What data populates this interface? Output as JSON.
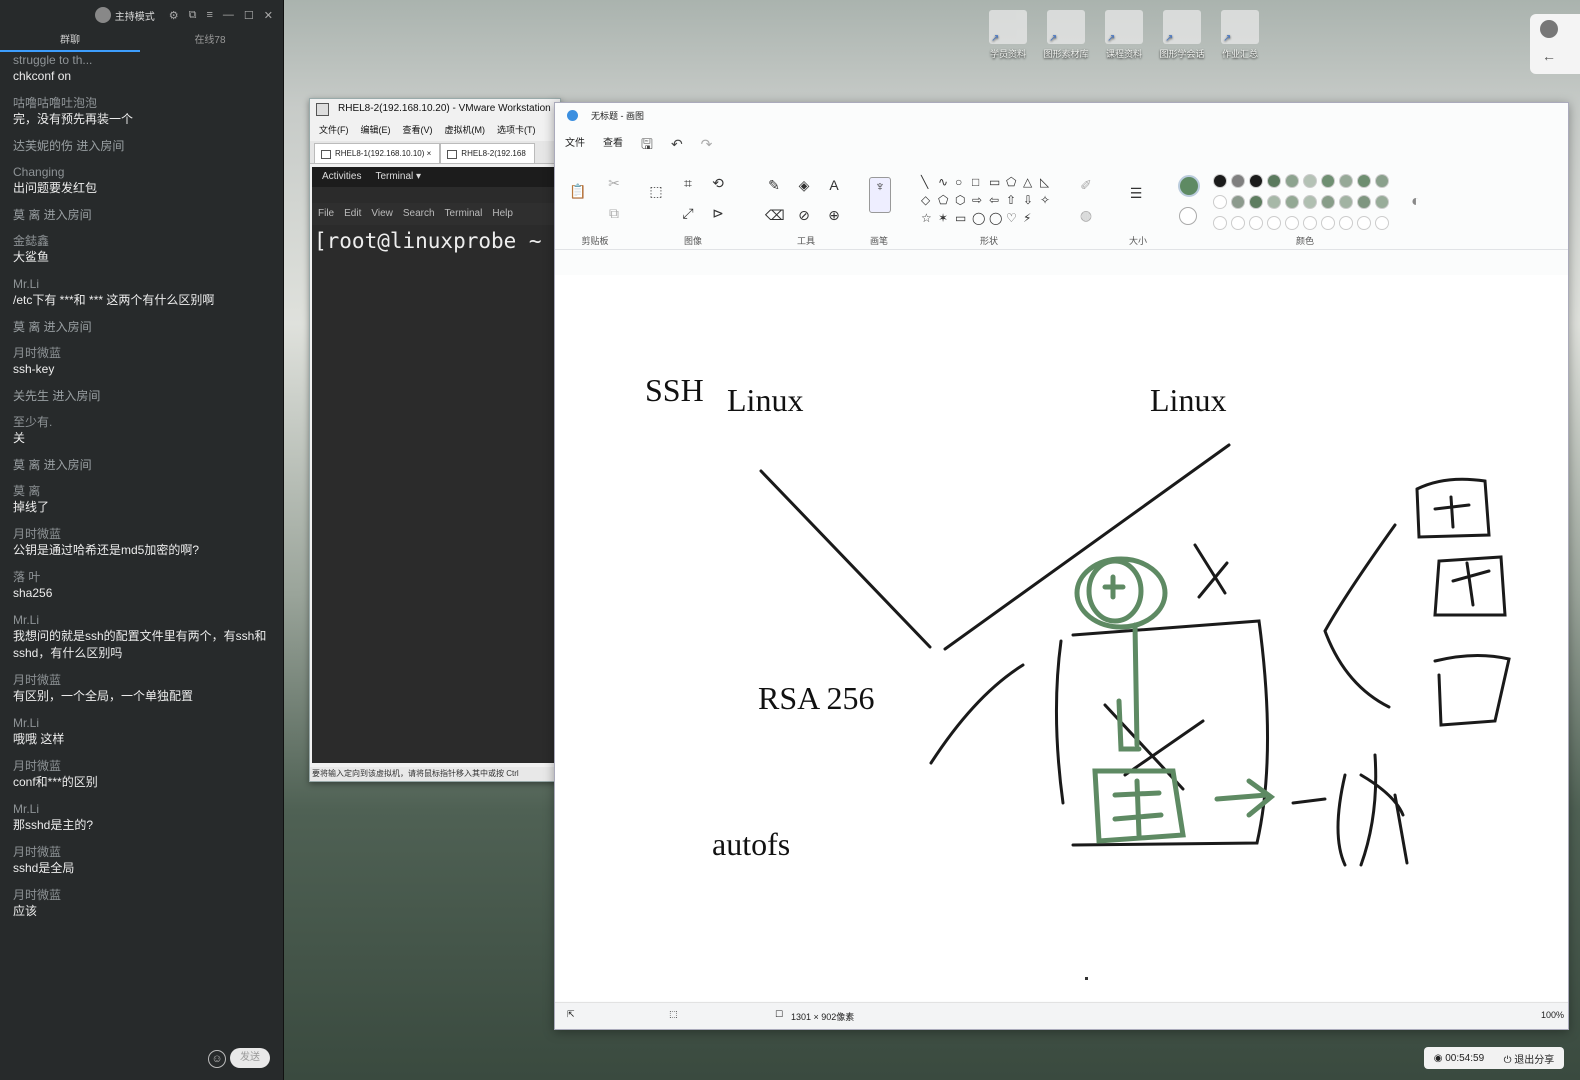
{
  "chat": {
    "mode_label": "主持模式",
    "tabs": [
      {
        "label": "群聊"
      },
      {
        "label": "在线78"
      }
    ],
    "messages": [
      {
        "nick": "struggle to th...",
        "text": "chkconf on"
      },
      {
        "nick": "咕噜咕噜吐泡泡",
        "text": "完，没有预先再装一个"
      },
      {
        "nick": "达芙妮的伤 进入房间",
        "text": ""
      },
      {
        "nick": "Changing",
        "text": "出问题要发红包"
      },
      {
        "nick": "莫 离 进入房间",
        "text": ""
      },
      {
        "nick": "金鋕鑫",
        "text": "大鲨鱼"
      },
      {
        "nick": "Mr.Li",
        "text": "/etc下有 ***和 *** 这两个有什么区别啊"
      },
      {
        "nick": "莫 离 进入房间",
        "text": ""
      },
      {
        "nick": "月时微蓝",
        "text": "ssh-key"
      },
      {
        "nick": "关先生 进入房间",
        "text": ""
      },
      {
        "nick": "至少有.",
        "text": "关"
      },
      {
        "nick": "莫 离 进入房间",
        "text": ""
      },
      {
        "nick": "莫 离",
        "text": "掉线了"
      },
      {
        "nick": "月时微蓝",
        "text": "公钥是通过哈希还是md5加密的啊?"
      },
      {
        "nick": "落 叶",
        "text": "sha256"
      },
      {
        "nick": "Mr.Li",
        "text": "我想问的就是ssh的配置文件里有两个，有ssh和sshd，有什么区别吗"
      },
      {
        "nick": "月时微蓝",
        "text": "有区别，一个全局，一个单独配置"
      },
      {
        "nick": "Mr.Li",
        "text": "哦哦 这样"
      },
      {
        "nick": "月时微蓝",
        "text": "conf和***的区别"
      },
      {
        "nick": "Mr.Li",
        "text": "那sshd是主的?"
      },
      {
        "nick": "月时微蓝",
        "text": "sshd是全局"
      },
      {
        "nick": "月时微蓝",
        "text": "应该"
      }
    ],
    "send_label": "发送"
  },
  "desktop": {
    "icons": [
      {
        "label": "学员资料"
      },
      {
        "label": "图形素材库"
      },
      {
        "label": "课程资料"
      },
      {
        "label": "图形学会话"
      },
      {
        "label": "作业汇总"
      }
    ]
  },
  "vmware": {
    "title": "RHEL8-2(192.168.10.20) - VMware Workstation",
    "menu": [
      "文件(F)",
      "编辑(E)",
      "查看(V)",
      "虚拟机(M)",
      "选项卡(T)"
    ],
    "tabs": [
      {
        "label": "RHEL8-1(192.168.10.10)"
      },
      {
        "label": "RHEL8-2(192.168"
      }
    ],
    "gnome_bar": {
      "activities": "Activities",
      "app": "Terminal ▾"
    },
    "terminal_menu": [
      "File",
      "Edit",
      "View",
      "Search",
      "Terminal",
      "Help"
    ],
    "prompt": "[root@linuxprobe ~",
    "status": "要将输入定向到该虚拟机，请将鼠标指针移入其中或按 Ctrl"
  },
  "paint": {
    "title": "无标题 - 画图",
    "menu": [
      "文件",
      "查看"
    ],
    "groups": [
      "剪贴板",
      "图像",
      "工具",
      "画笔",
      "形状",
      "大小",
      "颜色"
    ],
    "canvas_text": [
      "SSH",
      "Linux",
      "Linux",
      "RSA 256",
      "autofs"
    ],
    "status": {
      "size": "1301 × 902像素",
      "zoom": "100%"
    },
    "stroke_colors": {
      "black": "#1a1a1a",
      "green": "#5e8a63"
    },
    "palette": [
      "#1b1b1b",
      "#7f7f7f",
      "#1b1b1b",
      "#5b7a5e",
      "#8da38f",
      "#b5c2b6",
      "#6f8f72",
      "#97a998",
      "#6e8e70",
      "#8aa08c",
      "#ffffff",
      "#8c9a8d",
      "#5e7d60",
      "#a7b8a8",
      "#93a894",
      "#b0bfb1",
      "#889d89",
      "#a2b3a3",
      "#7f9680",
      "#98ac99",
      "#ffffff",
      "#ffffff",
      "#ffffff",
      "#ffffff",
      "#ffffff",
      "#ffffff",
      "#ffffff",
      "#ffffff",
      "#ffffff",
      "#ffffff"
    ]
  },
  "tray": {
    "timer": "00:54:59",
    "exit_share": "退出分享"
  }
}
